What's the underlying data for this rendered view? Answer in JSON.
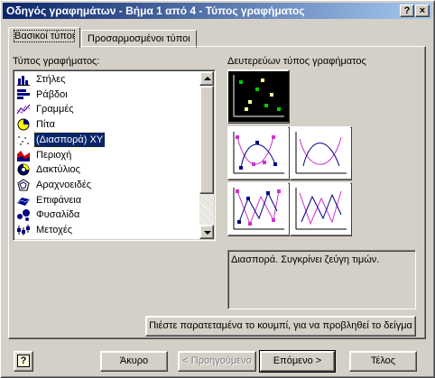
{
  "window": {
    "title": "Οδηγός γραφημάτων - Βήμα 1 από 4 - Τύπος γραφήματος",
    "help_glyph": "?",
    "close_glyph": "×"
  },
  "tabs": [
    {
      "label": "Βασικοί τύποι",
      "active": true
    },
    {
      "label": "Προσαρμοσμένοι τύποι",
      "active": false
    }
  ],
  "chart_type": {
    "label": "Τύπος γραφήματος:",
    "items": [
      {
        "label": "Στήλες",
        "icon": "column-chart-icon"
      },
      {
        "label": "Ράβδοι",
        "icon": "bar-chart-icon"
      },
      {
        "label": "Γραμμές",
        "icon": "line-chart-icon"
      },
      {
        "label": "Πίτα",
        "icon": "pie-chart-icon"
      },
      {
        "label": "(Διασπορά) XY",
        "icon": "scatter-chart-icon",
        "selected": true
      },
      {
        "label": "Περιοχή",
        "icon": "area-chart-icon"
      },
      {
        "label": "Δακτύλιος",
        "icon": "doughnut-chart-icon"
      },
      {
        "label": "Αραχνοειδές",
        "icon": "radar-chart-icon"
      },
      {
        "label": "Επιφάνεια",
        "icon": "surface-chart-icon"
      },
      {
        "label": "Φυσαλίδα",
        "icon": "bubble-chart-icon"
      },
      {
        "label": "Μετοχές",
        "icon": "stock-chart-icon"
      }
    ]
  },
  "subtype": {
    "label": "Δευτερεύων τύπος γραφήματος",
    "items": [
      {
        "name": "scatter-markers-only",
        "selected": true
      },
      {
        "name": "scatter-smooth-lines-markers"
      },
      {
        "name": "scatter-smooth-lines"
      },
      {
        "name": "scatter-straight-lines-markers"
      },
      {
        "name": "scatter-straight-lines"
      }
    ],
    "description": "Διασπορά. Συγκρίνει ζεύγη τιμών."
  },
  "preview_button": "Πιέστε παρατεταμένα το κουμπί, για να προβληθεί το δείγμα",
  "footer": {
    "help_glyph": "?",
    "cancel": "Άκυρο",
    "back": "< Προηγούμενο",
    "next": "Επόμενο >",
    "finish": "Τέλος"
  },
  "colors": {
    "titlebar_start": "#0a246a",
    "titlebar_end": "#a6caf0",
    "selection": "#0a246a",
    "marker_green": "#00cc00",
    "marker_yellow": "#ffff99",
    "series_magenta": "#cc33cc",
    "series_navy": "#000080"
  }
}
